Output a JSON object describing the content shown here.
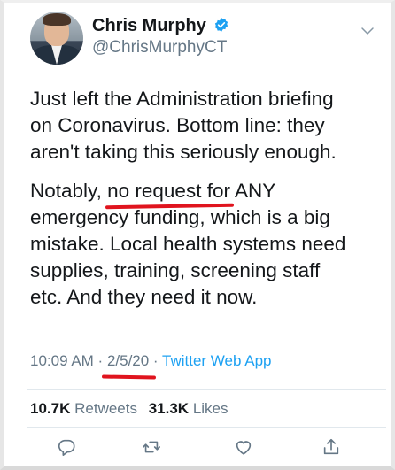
{
  "author": {
    "name": "Chris Murphy",
    "handle": "@ChrisMurphyCT",
    "verified_icon": "verified-badge-icon"
  },
  "tweet": {
    "para1": "Just left the Administration briefing\non Coronavirus. Bottom line: they\naren't taking this seriously enough.",
    "para2_before": "Notably, ",
    "para2_underlined": "no request for",
    "para2_after": " ANY\nemergency funding, which is a big\nmistake. Local health systems need\nsupplies, training, screening staff\netc. And they need it now."
  },
  "meta": {
    "time": "10:09 AM",
    "sep1": " · ",
    "date": "2/5/20",
    "sep2": " · ",
    "app": "Twitter Web App"
  },
  "stats": {
    "retweets_count": "10.7K",
    "retweets_label": "Retweets",
    "likes_count": "31.3K",
    "likes_label": "Likes"
  },
  "colors": {
    "accent": "#1da1f2",
    "annotation_red": "#e0141e",
    "muted": "#657786"
  }
}
